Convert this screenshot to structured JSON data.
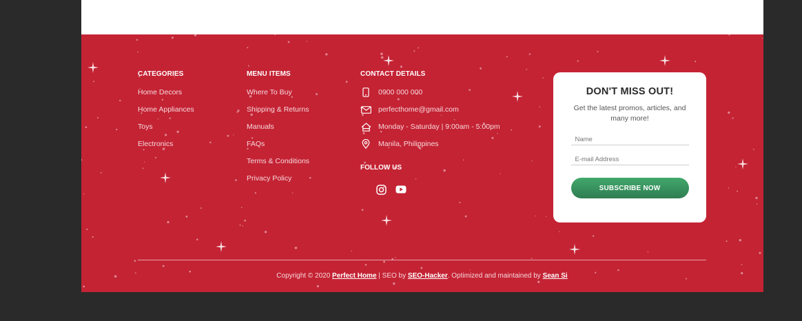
{
  "categories": {
    "title": "CATEGORIES",
    "items": [
      "Home Decors",
      "Home Appliances",
      "Toys",
      "Electronics"
    ]
  },
  "menu_items": {
    "title": "MENU ITEMS",
    "items": [
      "Where To Buy",
      "Shipping & Returns",
      "Manuals",
      "FAQs",
      "Terms & Conditions",
      "Privacy Policy"
    ]
  },
  "contact": {
    "title": "CONTACT DETAILS",
    "phone": "0900 000 000",
    "email": "perfecthome@gmail.com",
    "hours": "Monday - Saturday | 9:00am - 5:00pm",
    "location": "Manila, Philippines",
    "icons": [
      "mobile-phone-icon",
      "envelope-icon",
      "home-icon",
      "map-pin-icon"
    ]
  },
  "follow": {
    "title": "FOLLOW US",
    "icons": [
      "instagram-icon",
      "youtube-icon"
    ]
  },
  "newsletter": {
    "title": "DON'T MISS OUT!",
    "subtitle": "Get the latest promos, articles, and many more!",
    "name_placeholder": "Name",
    "email_placeholder": "E-mail Address",
    "button_label": "SUBSCRIBE NOW"
  },
  "copyright": {
    "prefix": "Copyright © 2020",
    "brand": "Perfect Home",
    "seo_text": "| SEO by",
    "seo_link": "SEO-Hacker",
    "maint_text": ". Optimized and maintained by",
    "maint_link": "Sean Si"
  },
  "colors": {
    "footer_bg": "#c42334",
    "button_green": "#3a9663",
    "page_bg": "#2a2a2a"
  }
}
